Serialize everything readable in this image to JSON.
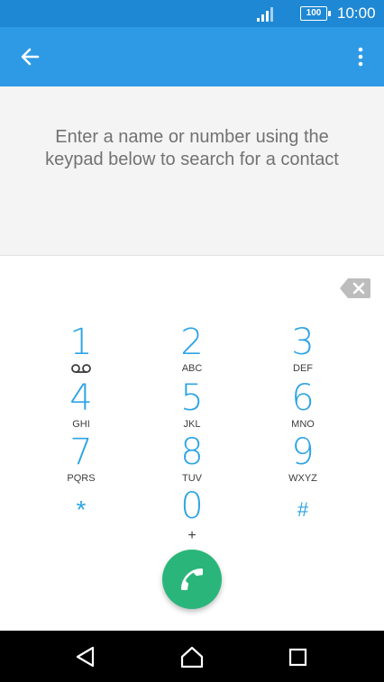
{
  "status_bar": {
    "time": "10:00",
    "battery": "100",
    "signal_icon": "signal-bars-icon"
  },
  "app_bar": {
    "back_icon": "arrow-back-icon",
    "more_icon": "more-vertical-icon"
  },
  "search": {
    "hint": "Enter a name or number using the keypad below to search for a contact"
  },
  "dialpad": {
    "backspace_icon": "backspace-icon",
    "keys": [
      {
        "digit": "1",
        "letters": "",
        "icon": "voicemail-icon"
      },
      {
        "digit": "2",
        "letters": "ABC"
      },
      {
        "digit": "3",
        "letters": "DEF"
      },
      {
        "digit": "4",
        "letters": "GHI"
      },
      {
        "digit": "5",
        "letters": "JKL"
      },
      {
        "digit": "6",
        "letters": "MNO"
      },
      {
        "digit": "7",
        "letters": "PQRS"
      },
      {
        "digit": "8",
        "letters": "TUV"
      },
      {
        "digit": "9",
        "letters": "WXYZ"
      },
      {
        "digit": "*",
        "letters": ""
      },
      {
        "digit": "0",
        "letters": "+"
      },
      {
        "digit": "#",
        "letters": ""
      }
    ],
    "call_icon": "phone-icon"
  },
  "nav_bar": {
    "back_icon": "nav-back-icon",
    "home_icon": "nav-home-icon",
    "recents_icon": "nav-recents-icon"
  },
  "colors": {
    "status_bar": "#1e88d4",
    "app_bar": "#2e9ae6",
    "accent": "#2ea4e5",
    "call_button": "#2ab67a",
    "nav_bar": "#000000"
  }
}
